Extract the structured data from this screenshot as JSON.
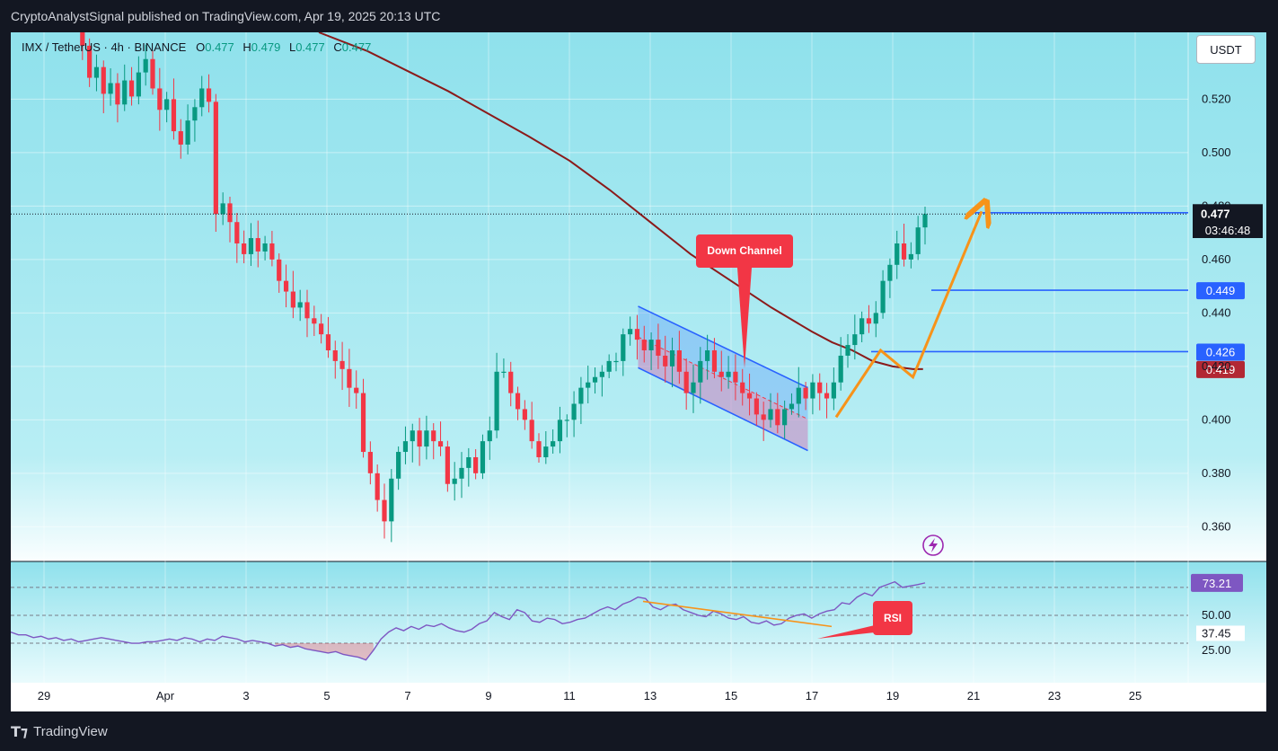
{
  "header": {
    "published": "CryptoAnalystSignal published on TradingView.com, Apr 19, 2025 20:13 UTC"
  },
  "legend": {
    "symbol": "IMX / TetherUS · 4h · BINANCE",
    "o_label": "O",
    "o": "0.477",
    "h_label": "H",
    "h": "0.479",
    "l_label": "L",
    "l": "0.477",
    "c_label": "C",
    "c": "0.477"
  },
  "currency_button": "USDT",
  "countdown": "03:46:48",
  "footer": {
    "brand": "TradingView"
  },
  "colors": {
    "bull": "#089981",
    "bear": "#f23645",
    "bg_cyan": "#8fe1ec",
    "ema": "#8b1a1a",
    "levels": "#2962ff",
    "arrow": "#f7931a",
    "rsi": "#7e57c2"
  },
  "chart_data": {
    "type": "candlestick",
    "symbol": "IMX / TetherUS",
    "timeframe": "4h",
    "exchange": "BINANCE",
    "current_price": 0.477,
    "ylim": [
      0.347,
      0.545
    ],
    "y_ticks": [
      "0.520",
      "0.500",
      "0.480",
      "0.460",
      "0.440",
      "0.420",
      "0.400",
      "0.380",
      "0.360"
    ],
    "x_ticks": [
      "29",
      "Apr",
      "3",
      "5",
      "7",
      "9",
      "11",
      "13",
      "15",
      "17",
      "19",
      "21",
      "23",
      "25"
    ],
    "x_tick_days": [
      -2,
      1,
      3,
      5,
      7,
      9,
      11,
      13,
      15,
      17,
      19,
      21,
      23,
      25
    ],
    "candle_closes": [
      0.545,
      0.54,
      0.528,
      0.532,
      0.522,
      0.526,
      0.518,
      0.527,
      0.521,
      0.53,
      0.535,
      0.524,
      0.516,
      0.52,
      0.508,
      0.503,
      0.512,
      0.517,
      0.524,
      0.519,
      0.477,
      0.481,
      0.474,
      0.466,
      0.462,
      0.468,
      0.463,
      0.466,
      0.46,
      0.452,
      0.448,
      0.442,
      0.444,
      0.438,
      0.436,
      0.432,
      0.426,
      0.422,
      0.419,
      0.412,
      0.41,
      0.388,
      0.38,
      0.37,
      0.362,
      0.378,
      0.388,
      0.392,
      0.396,
      0.39,
      0.396,
      0.392,
      0.39,
      0.376,
      0.378,
      0.382,
      0.386,
      0.38,
      0.392,
      0.396,
      0.418,
      0.418,
      0.41,
      0.404,
      0.4,
      0.392,
      0.386,
      0.39,
      0.392,
      0.4,
      0.4,
      0.406,
      0.412,
      0.414,
      0.416,
      0.418,
      0.422,
      0.422,
      0.432,
      0.434,
      0.43,
      0.426,
      0.43,
      0.424,
      0.42,
      0.426,
      0.418,
      0.41,
      0.414,
      0.422,
      0.426,
      0.418,
      0.416,
      0.418,
      0.414,
      0.41,
      0.408,
      0.402,
      0.4,
      0.404,
      0.398,
      0.404,
      0.406,
      0.412,
      0.408,
      0.414,
      0.41,
      0.408,
      0.414,
      0.424,
      0.428,
      0.432,
      0.438,
      0.436,
      0.44,
      0.452,
      0.458,
      0.466,
      0.46,
      0.462,
      0.472,
      0.477
    ],
    "ema": {
      "days": [
        4.8,
        6,
        8,
        10,
        11,
        12,
        13,
        14,
        15,
        16,
        17,
        17.5,
        18,
        18.5,
        19,
        19.5,
        19.75
      ],
      "values": [
        0.545,
        0.538,
        0.523,
        0.506,
        0.497,
        0.486,
        0.474,
        0.462,
        0.452,
        0.442,
        0.433,
        0.429,
        0.426,
        0.422,
        0.42,
        0.419,
        0.419
      ]
    },
    "horizontal_levels": [
      {
        "label": "0.480",
        "value": 0.4775,
        "color": "#2962ff"
      },
      {
        "label": "0.449",
        "value": 0.4485,
        "color": "#2962ff"
      },
      {
        "label": "0.426",
        "value": 0.4255,
        "color": "#2962ff"
      },
      {
        "label": "0.419",
        "value": 0.419,
        "color": "#b22833"
      }
    ],
    "last_price_label": "0.477",
    "channel": {
      "upper": [
        [
          12.7,
          0.4425
        ],
        [
          16.9,
          0.412
        ]
      ],
      "lower": [
        [
          12.7,
          0.4195
        ],
        [
          16.9,
          0.3885
        ]
      ]
    },
    "annotations": [
      {
        "text": "Down Channel",
        "kind": "callout"
      },
      {
        "text": "RSI",
        "kind": "callout"
      }
    ],
    "projection_arrow": [
      [
        17.6,
        0.401
      ],
      [
        18.7,
        0.426
      ],
      [
        19.5,
        0.416
      ],
      [
        21.2,
        0.478
      ]
    ],
    "rsi": {
      "current": 73.21,
      "ticks": [
        "50.00",
        "25.00"
      ],
      "marked_value": "37.45",
      "ylim": [
        3,
        86
      ],
      "levels": [
        70,
        50,
        30
      ],
      "values": [
        38,
        36,
        36,
        34,
        35,
        33,
        34,
        32,
        33,
        31,
        32,
        33,
        34,
        33,
        32,
        31,
        30,
        30,
        31,
        31,
        32,
        33,
        32,
        34,
        33,
        31,
        33,
        32,
        35,
        34,
        33,
        31,
        32,
        31,
        30,
        28,
        29,
        27,
        28,
        26,
        25,
        24,
        23,
        24,
        22,
        21,
        20,
        18,
        25,
        33,
        38,
        41,
        39,
        42,
        40,
        43,
        42,
        44,
        41,
        39,
        38,
        40,
        44,
        46,
        52,
        49,
        47,
        54,
        52,
        46,
        45,
        48,
        47,
        44,
        45,
        47,
        48,
        51,
        54,
        56,
        54,
        58,
        60,
        63,
        62,
        56,
        54,
        57,
        58,
        54,
        52,
        50,
        49,
        53,
        51,
        48,
        47,
        49,
        45,
        44,
        46,
        43,
        44,
        48,
        50,
        51,
        48,
        51,
        53,
        54,
        59,
        58,
        63,
        66,
        64,
        70,
        72,
        74,
        70,
        71,
        72,
        73.21
      ]
    }
  }
}
